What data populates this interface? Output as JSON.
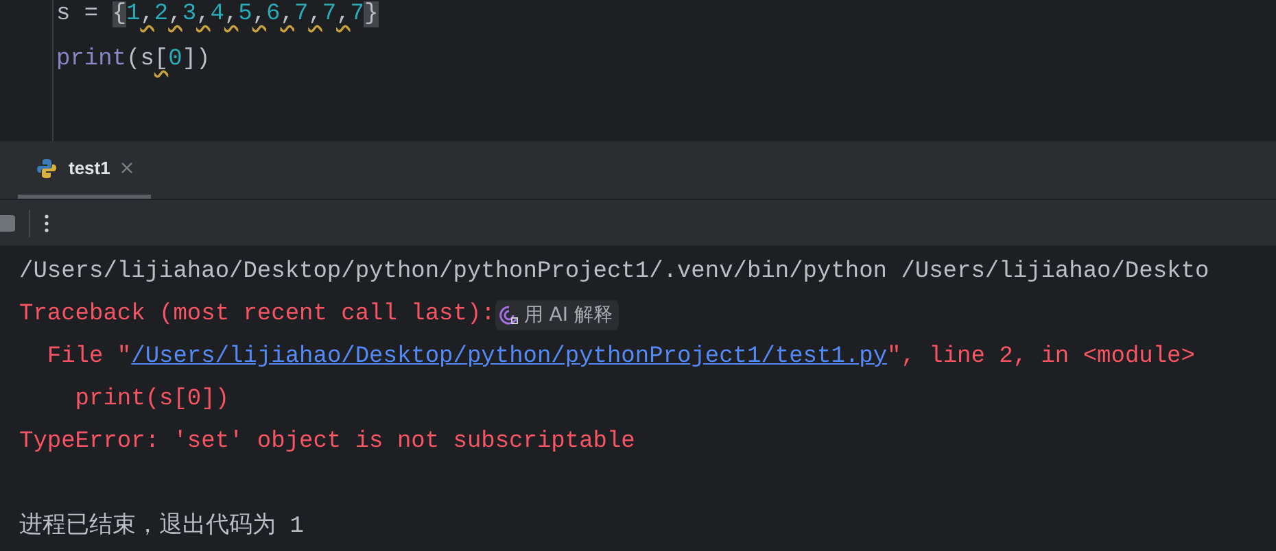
{
  "editor": {
    "lines": [
      {
        "tokens": [
          {
            "text": "s",
            "kind": "ident",
            "warning": false
          },
          {
            "text": " = ",
            "kind": "op",
            "warning": false
          },
          {
            "text": "{",
            "kind": "brace",
            "warning": false
          },
          {
            "text": "1",
            "kind": "number",
            "warning": false
          },
          {
            "text": ",",
            "kind": "op",
            "warning": true
          },
          {
            "text": "2",
            "kind": "number",
            "warning": false
          },
          {
            "text": ",",
            "kind": "op",
            "warning": true
          },
          {
            "text": "3",
            "kind": "number",
            "warning": false
          },
          {
            "text": ",",
            "kind": "op",
            "warning": true
          },
          {
            "text": "4",
            "kind": "number",
            "warning": false
          },
          {
            "text": ",",
            "kind": "op",
            "warning": true
          },
          {
            "text": "5",
            "kind": "number",
            "warning": false
          },
          {
            "text": ",",
            "kind": "op",
            "warning": true
          },
          {
            "text": "6",
            "kind": "number",
            "warning": false
          },
          {
            "text": ",",
            "kind": "op",
            "warning": true
          },
          {
            "text": "7",
            "kind": "number",
            "warning": false
          },
          {
            "text": ",",
            "kind": "op",
            "warning": true
          },
          {
            "text": "7",
            "kind": "number",
            "warning": false
          },
          {
            "text": ",",
            "kind": "op",
            "warning": true
          },
          {
            "text": "7",
            "kind": "number",
            "warning": false
          },
          {
            "text": "}",
            "kind": "brace",
            "warning": false
          }
        ]
      },
      {
        "tokens": [
          {
            "text": "print",
            "kind": "func",
            "warning": false
          },
          {
            "text": "(s",
            "kind": "op",
            "warning": false
          },
          {
            "text": "[",
            "kind": "op",
            "warning": true
          },
          {
            "text": "0",
            "kind": "number",
            "warning": false
          },
          {
            "text": "])",
            "kind": "op",
            "warning": false
          }
        ]
      }
    ]
  },
  "run_tabs": [
    {
      "label": "test1",
      "selected": true
    }
  ],
  "console": {
    "lines": [
      {
        "segments": [
          {
            "kind": "plain",
            "text": "/Users/lijiahao/Desktop/python/pythonProject1/.venv/bin/python /Users/lijiahao/Deskto"
          }
        ]
      },
      {
        "segments": [
          {
            "kind": "error",
            "text": "Traceback (most recent call last):"
          },
          {
            "kind": "ai_button",
            "text": "用 AI 解释"
          }
        ]
      },
      {
        "segments": [
          {
            "kind": "error",
            "text": "  File \""
          },
          {
            "kind": "link",
            "text": "/Users/lijiahao/Desktop/python/pythonProject1/test1.py"
          },
          {
            "kind": "error",
            "text": "\", line 2, in <module>"
          }
        ]
      },
      {
        "segments": [
          {
            "kind": "error",
            "text": "    print(s[0])"
          }
        ]
      },
      {
        "segments": [
          {
            "kind": "error",
            "text": "TypeError: 'set' object is not subscriptable"
          }
        ]
      },
      {
        "kind": "blank"
      },
      {
        "segments": [
          {
            "kind": "plain",
            "text": "进程已结束，退出代码为 1"
          }
        ]
      }
    ]
  }
}
